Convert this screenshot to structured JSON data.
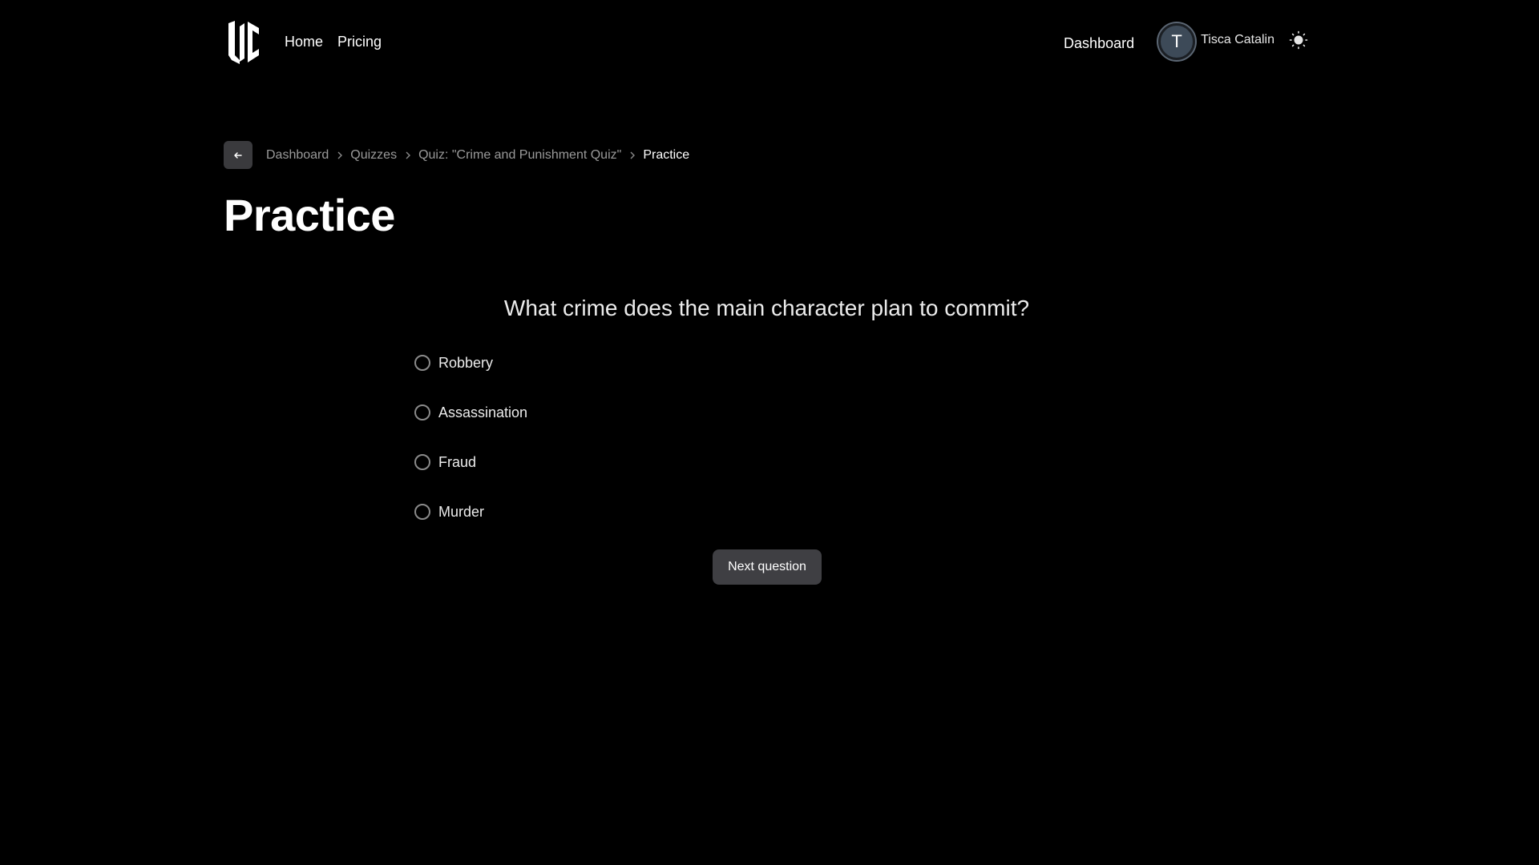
{
  "header": {
    "logo_alt": "LC",
    "nav": [
      "Home",
      "Pricing"
    ],
    "dashboard_link": "Dashboard",
    "avatar_initial": "T",
    "user_name": "Tisca Catalin",
    "theme_icon": "sun-icon"
  },
  "breadcrumb": {
    "back_icon": "arrow-left-icon",
    "items": [
      "Dashboard",
      "Quizzes",
      "Quiz: \"Crime and Punishment Quiz\"",
      "Practice"
    ]
  },
  "page_title": "Practice",
  "quiz": {
    "question": "What crime does the main character plan to commit?",
    "options": [
      "Robbery",
      "Assassination",
      "Fraud",
      "Murder"
    ],
    "next_button": "Next question"
  },
  "colors": {
    "background": "#000000",
    "button_bg": "#3f3f43",
    "muted_text": "#9a9a9a"
  }
}
